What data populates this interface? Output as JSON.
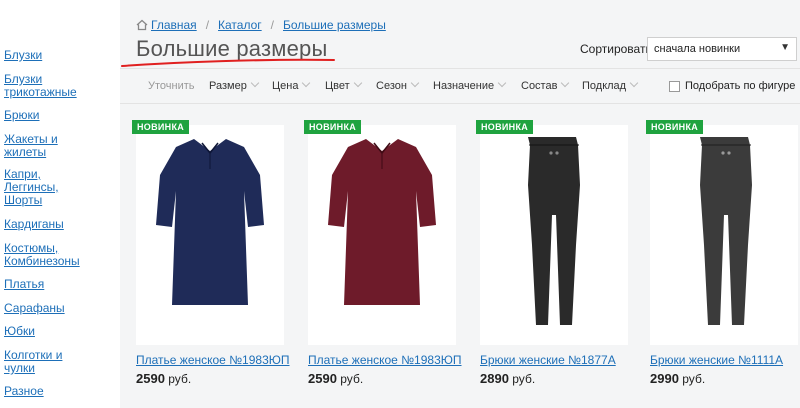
{
  "sidebar": {
    "items": [
      {
        "label": "Блузки"
      },
      {
        "label": "Блузки\nтрикотажные"
      },
      {
        "label": "Брюки"
      },
      {
        "label": "Жакеты и\nжилеты"
      },
      {
        "label": "Капри,\nЛеггинсы,\nШорты"
      },
      {
        "label": "Кардиганы"
      },
      {
        "label": "Костюмы,\nКомбинезоны"
      },
      {
        "label": "Платья"
      },
      {
        "label": "Сарафаны"
      },
      {
        "label": "Юбки"
      },
      {
        "label": "Колготки и\nчулки"
      },
      {
        "label": "Разное"
      }
    ]
  },
  "breadcrumb": {
    "home": "Главная",
    "catalog": "Каталог",
    "current": "Большие размеры",
    "separator": "/"
  },
  "page": {
    "title": "Большие размеры"
  },
  "sort": {
    "label": "Сортировать",
    "value": "сначала новинки"
  },
  "filters": {
    "refine": "Уточнить",
    "items": [
      "Размер",
      "Цена",
      "Цвет",
      "Сезон",
      "Назначение",
      "Состав",
      "Подклад"
    ],
    "figure_checkbox": "Подобрать по фигуре"
  },
  "products": [
    {
      "badge": "НОВИНКА",
      "name": "Платье женское №1983ЮП",
      "price": "2590",
      "currency": "руб.",
      "color": "#1f2b58"
    },
    {
      "badge": "НОВИНКА",
      "name": "Платье женское №1983ЮП",
      "price": "2590",
      "currency": "руб.",
      "color": "#6e1b2a"
    },
    {
      "badge": "НОВИНКА",
      "name": "Брюки женские №1877А",
      "price": "2890",
      "currency": "руб.",
      "color": "#2a2a2a"
    },
    {
      "badge": "НОВИНКА",
      "name": "Брюки женские №1111А",
      "price": "2990",
      "currency": "руб.",
      "color": "#3b3b3b"
    }
  ],
  "colors": {
    "link": "#1d6fb8",
    "badge": "#1fa33f",
    "annotation": "#e02020"
  }
}
